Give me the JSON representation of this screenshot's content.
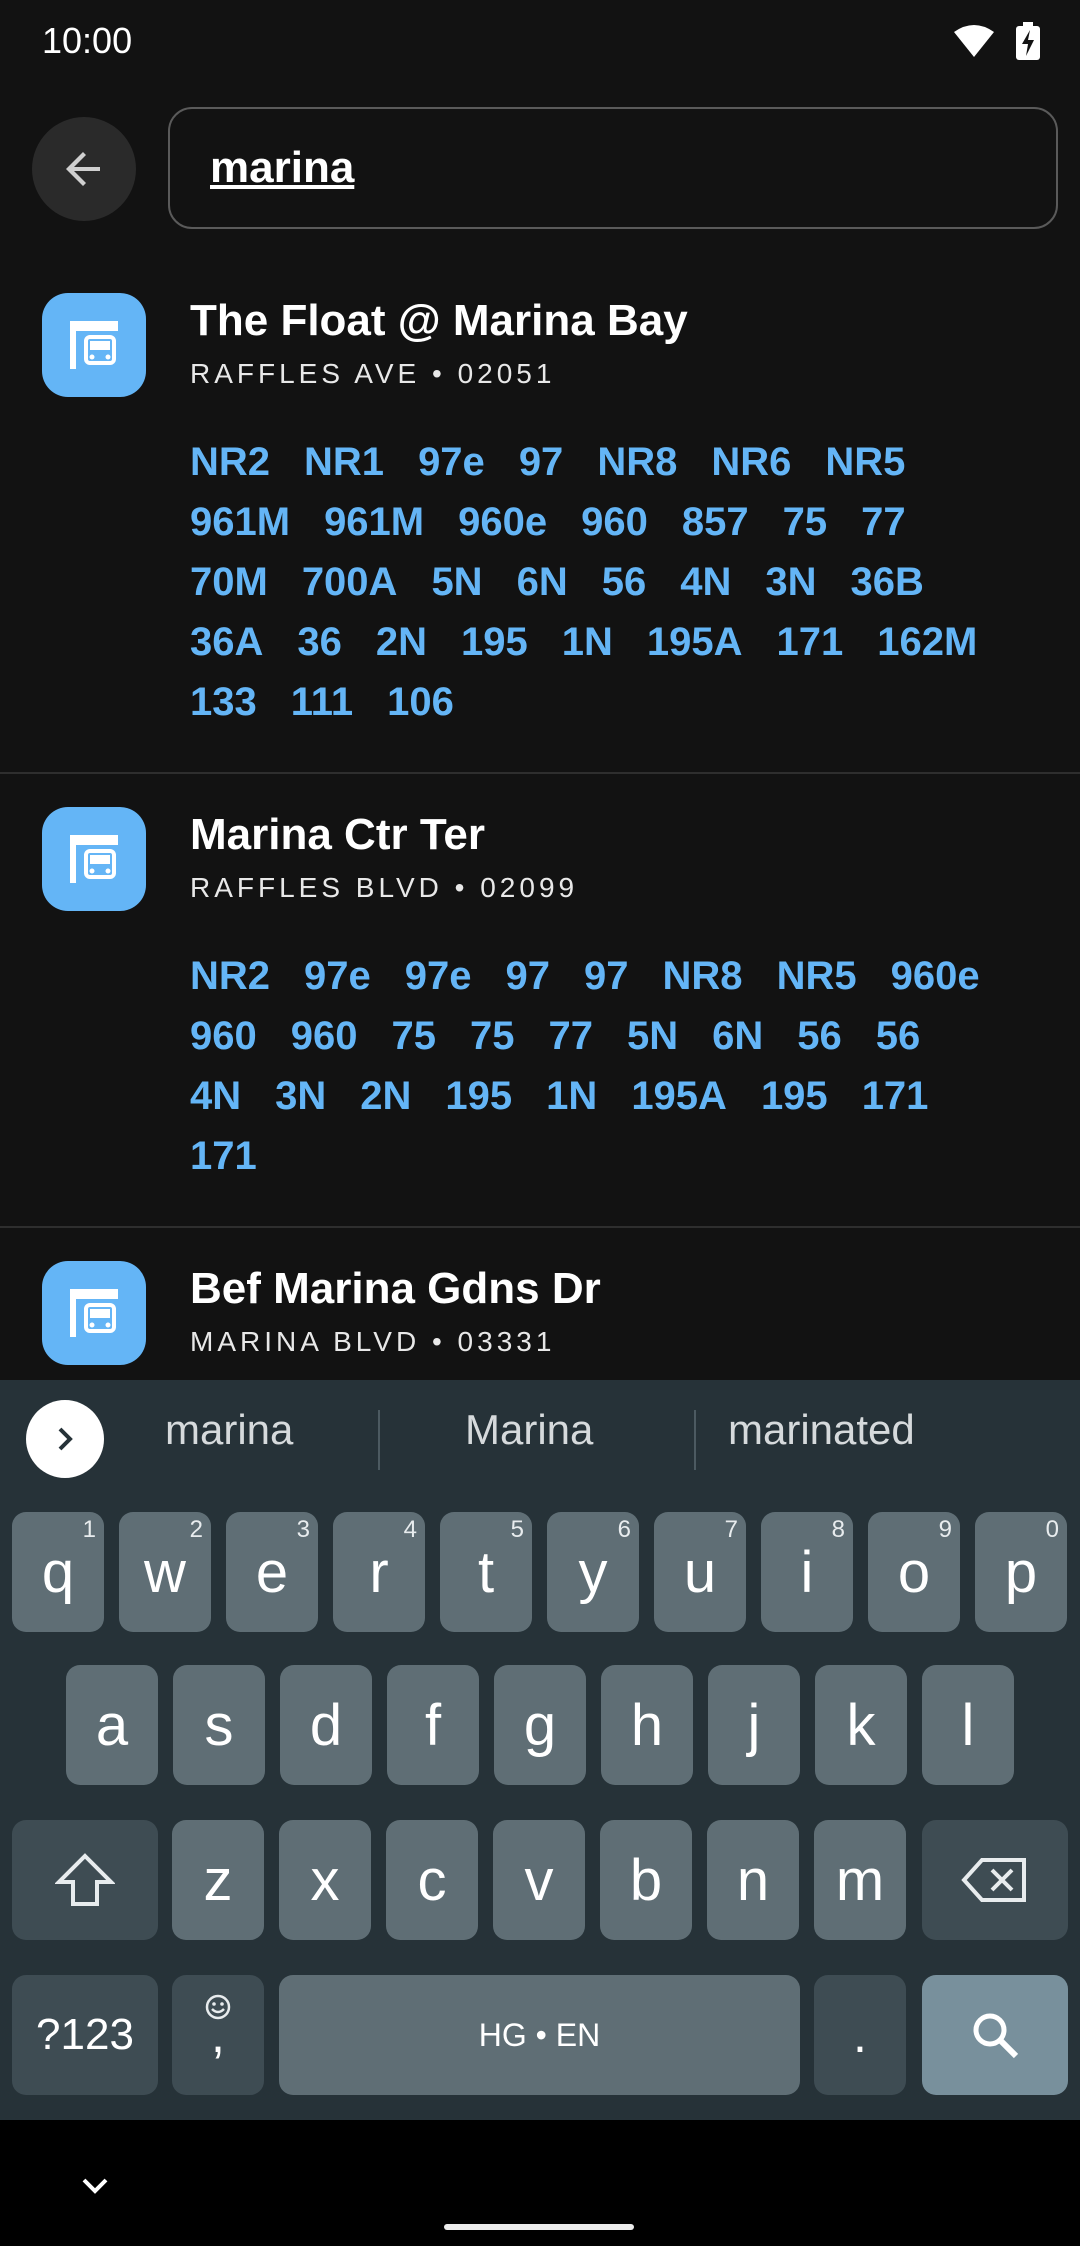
{
  "status": {
    "time": "10:00"
  },
  "search": {
    "query": "marina"
  },
  "stops": [
    {
      "name": "The Float @ Marina Bay",
      "subtitle": "RAFFLES AVE • 02051",
      "routes": [
        "NR2",
        "NR1",
        "97e",
        "97",
        "NR8",
        "NR6",
        "NR5",
        "961M",
        "961M",
        "960e",
        "960",
        "857",
        "75",
        "77",
        "70M",
        "700A",
        "5N",
        "6N",
        "56",
        "4N",
        "3N",
        "36B",
        "36A",
        "36",
        "2N",
        "195",
        "1N",
        "195A",
        "171",
        "162M",
        "133",
        "111",
        "106"
      ]
    },
    {
      "name": "Marina Ctr Ter",
      "subtitle": "RAFFLES BLVD • 02099",
      "routes": [
        "NR2",
        "97e",
        "97e",
        "97",
        "97",
        "NR8",
        "NR5",
        "960e",
        "960",
        "960",
        "75",
        "75",
        "77",
        "5N",
        "6N",
        "56",
        "56",
        "4N",
        "3N",
        "2N",
        "195",
        "1N",
        "195A",
        "195",
        "171",
        "171"
      ]
    },
    {
      "name": "Bef Marina Gdns Dr",
      "subtitle": "MARINA BLVD • 03331",
      "routes": []
    }
  ],
  "keyboard": {
    "suggestions": [
      "marina",
      "Marina",
      "marinated"
    ],
    "row1": [
      {
        "k": "q",
        "n": "1"
      },
      {
        "k": "w",
        "n": "2"
      },
      {
        "k": "e",
        "n": "3"
      },
      {
        "k": "r",
        "n": "4"
      },
      {
        "k": "t",
        "n": "5"
      },
      {
        "k": "y",
        "n": "6"
      },
      {
        "k": "u",
        "n": "7"
      },
      {
        "k": "i",
        "n": "8"
      },
      {
        "k": "o",
        "n": "9"
      },
      {
        "k": "p",
        "n": "0"
      }
    ],
    "row2": [
      "a",
      "s",
      "d",
      "f",
      "g",
      "h",
      "j",
      "k",
      "l"
    ],
    "row3": [
      "z",
      "x",
      "c",
      "v",
      "b",
      "n",
      "m"
    ],
    "symbols_label": "?123",
    "comma_label": ",",
    "space_label": "HG • EN",
    "period_label": "."
  },
  "colors": {
    "accent": "#64b5f6",
    "background": "#121212",
    "keyboard": "#263238"
  }
}
